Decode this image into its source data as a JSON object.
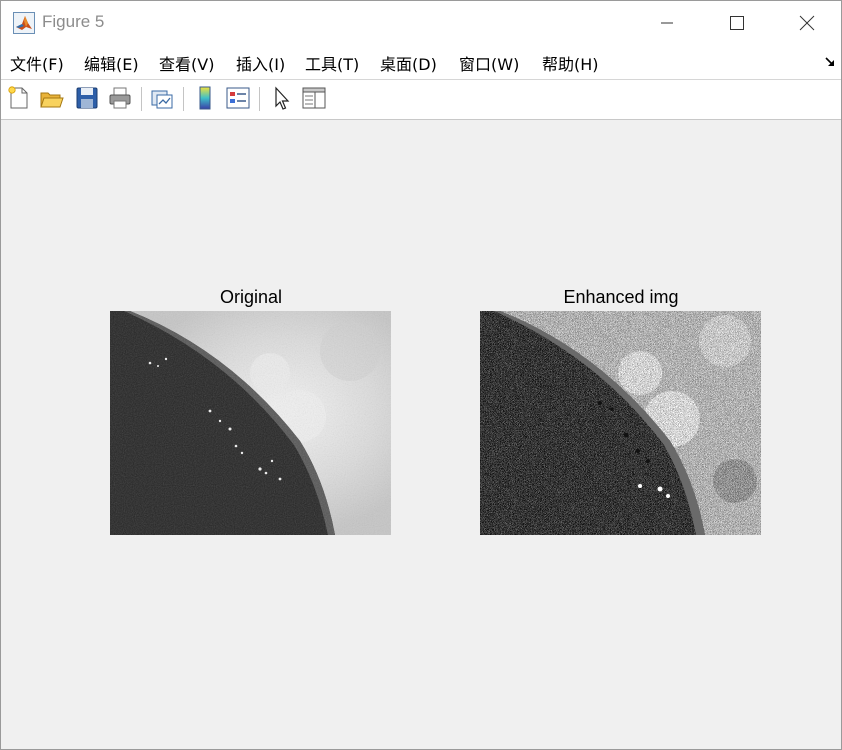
{
  "window": {
    "title": "Figure 5"
  },
  "menu": {
    "items": [
      {
        "label": "文件(F)"
      },
      {
        "label": "编辑(E)"
      },
      {
        "label": "查看(V)"
      },
      {
        "label": "插入(I)"
      },
      {
        "label": "工具(T)"
      },
      {
        "label": "桌面(D)"
      },
      {
        "label": "窗口(W)"
      },
      {
        "label": "帮助(H)"
      }
    ]
  },
  "toolbar": {
    "icons": [
      "new-figure-icon",
      "open-file-icon",
      "save-icon",
      "print-icon",
      "link-plot-icon",
      "colorbar-icon",
      "legend-icon",
      "edit-plot-arrow-icon",
      "property-inspector-icon"
    ]
  },
  "axes": [
    {
      "title": "Original"
    },
    {
      "title": "Enhanced img"
    }
  ]
}
